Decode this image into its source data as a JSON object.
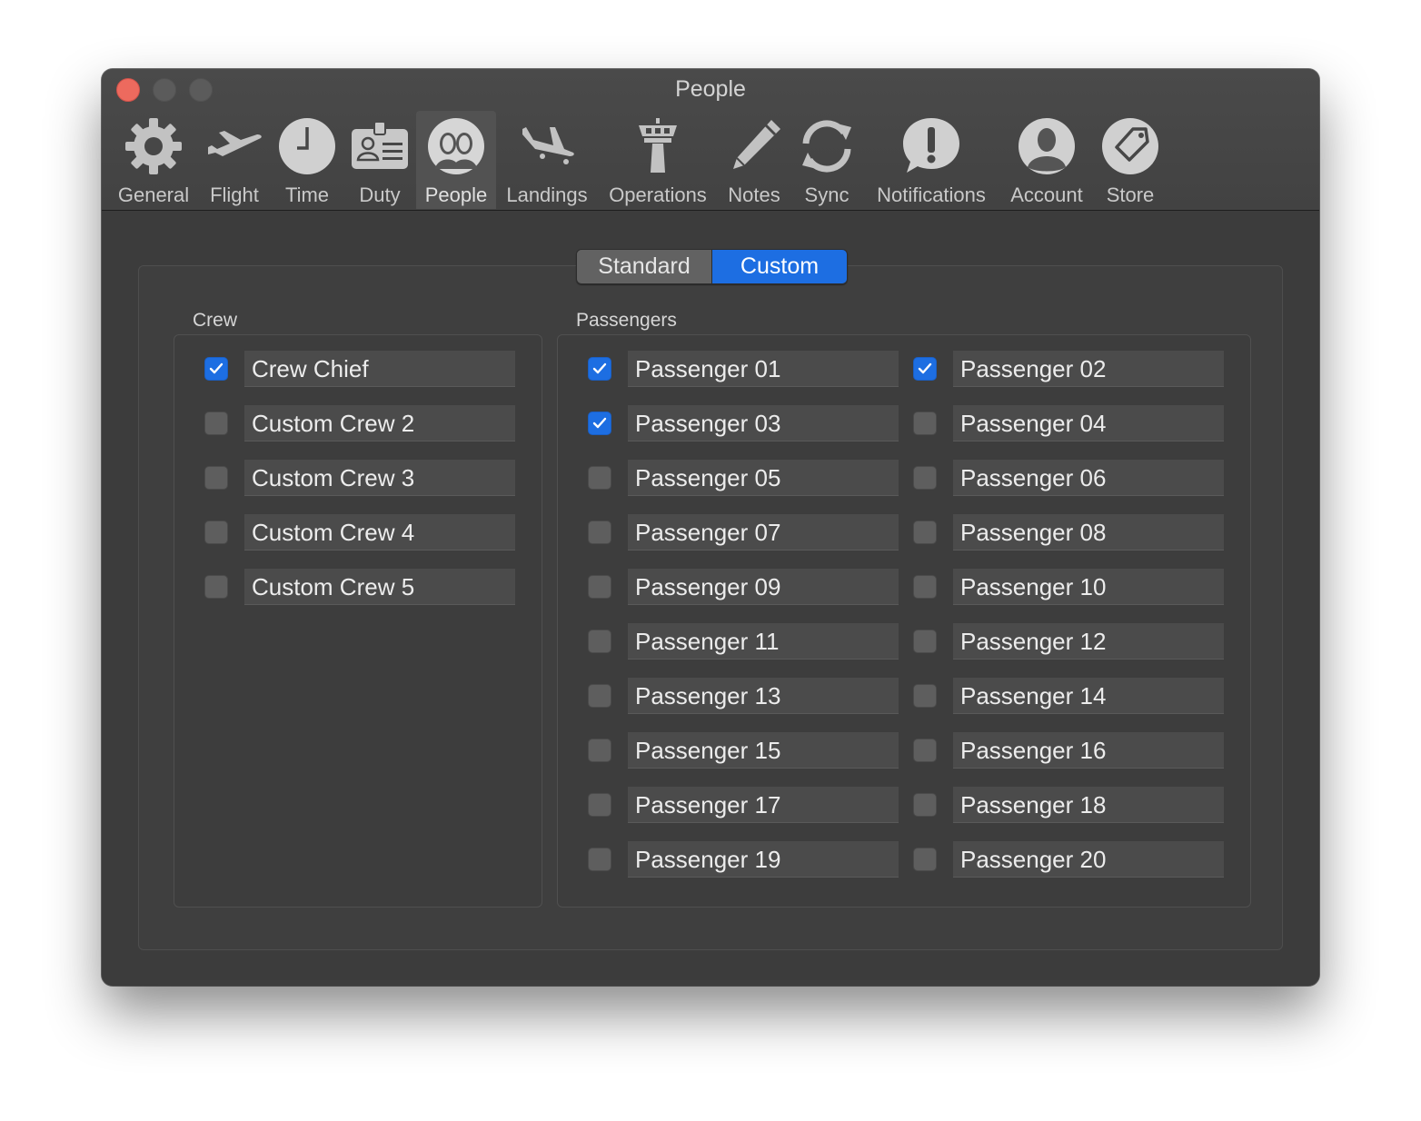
{
  "window": {
    "title": "People",
    "controls": {
      "close_color": "#ed6a5e",
      "minimize_color": "#5b5b5b",
      "zoom_color": "#5b5b5b"
    }
  },
  "toolbar": {
    "items": [
      {
        "label": "General",
        "icon": "gear-icon",
        "selected": false
      },
      {
        "label": "Flight",
        "icon": "airplane-icon",
        "selected": false
      },
      {
        "label": "Time",
        "icon": "clock-icon",
        "selected": false
      },
      {
        "label": "Duty",
        "icon": "id-badge-icon",
        "selected": false
      },
      {
        "label": "People",
        "icon": "people-icon",
        "selected": true
      },
      {
        "label": "Landings",
        "icon": "landing-airplane-icon",
        "selected": false
      },
      {
        "label": "Operations",
        "icon": "control-tower-icon",
        "selected": false
      },
      {
        "label": "Notes",
        "icon": "pencil-icon",
        "selected": false
      },
      {
        "label": "Sync",
        "icon": "sync-icon",
        "selected": false
      },
      {
        "label": "Notifications",
        "icon": "exclamation-bubble-icon",
        "selected": false
      },
      {
        "label": "Account",
        "icon": "person-icon",
        "selected": false
      },
      {
        "label": "Store",
        "icon": "tag-icon",
        "selected": false
      }
    ]
  },
  "segmented": {
    "options": [
      "Standard",
      "Custom"
    ],
    "selected": "Custom"
  },
  "crew": {
    "title": "Crew",
    "rows": [
      {
        "label": "Crew Chief",
        "checked": true
      },
      {
        "label": "Custom Crew 2",
        "checked": false
      },
      {
        "label": "Custom Crew 3",
        "checked": false
      },
      {
        "label": "Custom Crew 4",
        "checked": false
      },
      {
        "label": "Custom Crew 5",
        "checked": false
      }
    ]
  },
  "passengers": {
    "title": "Passengers",
    "rows": [
      {
        "label": "Passenger 01",
        "checked": true
      },
      {
        "label": "Passenger 02",
        "checked": true
      },
      {
        "label": "Passenger 03",
        "checked": true
      },
      {
        "label": "Passenger 04",
        "checked": false
      },
      {
        "label": "Passenger 05",
        "checked": false
      },
      {
        "label": "Passenger 06",
        "checked": false
      },
      {
        "label": "Passenger 07",
        "checked": false
      },
      {
        "label": "Passenger 08",
        "checked": false
      },
      {
        "label": "Passenger 09",
        "checked": false
      },
      {
        "label": "Passenger 10",
        "checked": false
      },
      {
        "label": "Passenger 11",
        "checked": false
      },
      {
        "label": "Passenger 12",
        "checked": false
      },
      {
        "label": "Passenger 13",
        "checked": false
      },
      {
        "label": "Passenger 14",
        "checked": false
      },
      {
        "label": "Passenger 15",
        "checked": false
      },
      {
        "label": "Passenger 16",
        "checked": false
      },
      {
        "label": "Passenger 17",
        "checked": false
      },
      {
        "label": "Passenger 18",
        "checked": false
      },
      {
        "label": "Passenger 19",
        "checked": false
      },
      {
        "label": "Passenger 20",
        "checked": false
      }
    ]
  },
  "colors": {
    "accent": "#1d6ee2",
    "window_bg": "#3c3c3c",
    "field_bg": "#4b4b4b"
  }
}
